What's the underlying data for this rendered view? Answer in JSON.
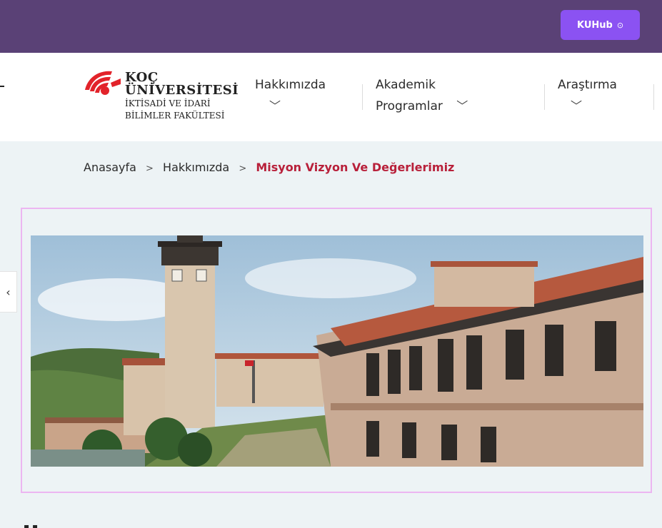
{
  "topbar": {
    "button_label": "KUHub",
    "button_icon": "arrow-circle-icon",
    "background": "#5a4176",
    "button_color": "#8b52f2"
  },
  "logo": {
    "line1": "KOÇ",
    "line2": "ÜNİVERSİTESİ",
    "line3": "İKTİSADİ VE İDARİ",
    "line4": "BİLİMLER FAKÜLTESİ",
    "mark_color": "#e2232a"
  },
  "nav": {
    "items": [
      {
        "line1": "Hakkımızda",
        "line2": ""
      },
      {
        "line1": "Akademik",
        "line2": "Programlar"
      },
      {
        "line1": "Araştırma",
        "line2": ""
      }
    ]
  },
  "breadcrumb": {
    "home": "Anasayfa",
    "parent": "Hakkımızda",
    "current": "Misyon Vizyon Ve Değerlerimiz",
    "current_color": "#b8203a"
  },
  "hero": {
    "image": "campus-clock-tower-photo"
  },
  "slider": {
    "prev_icon": "chevron-left-icon"
  }
}
